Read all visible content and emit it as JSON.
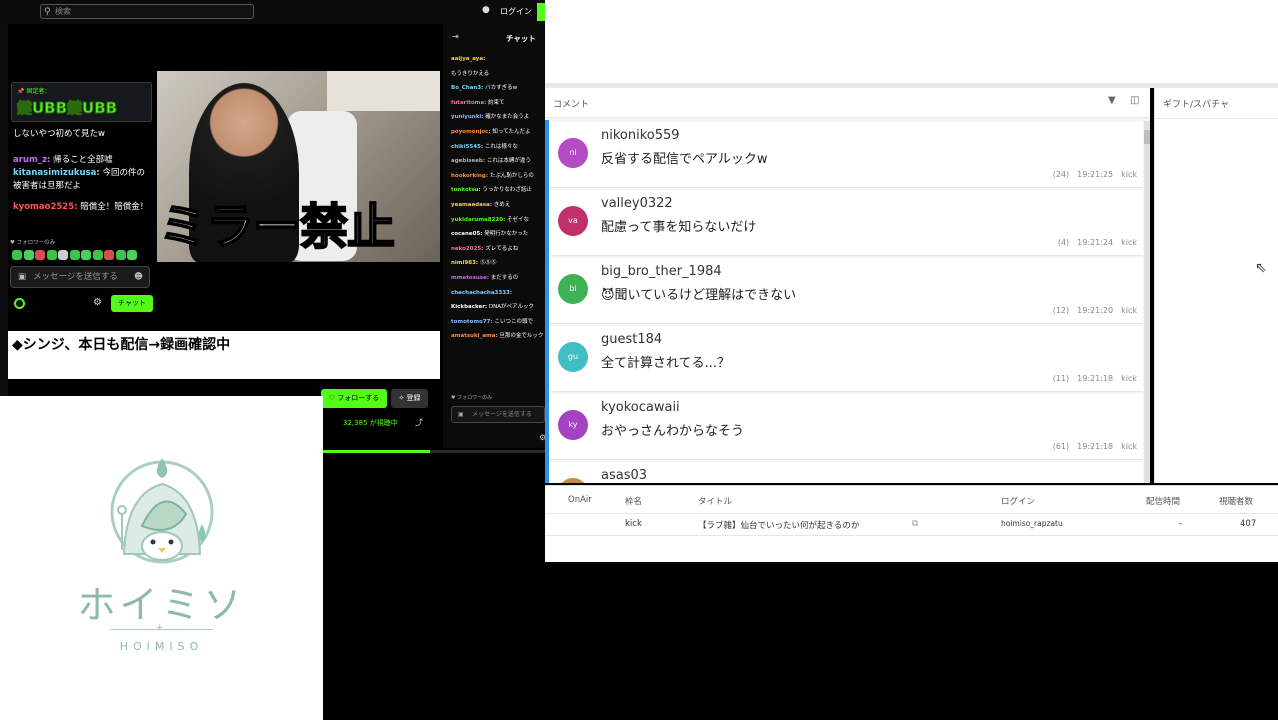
{
  "kick": {
    "search_placeholder": "検索",
    "login": "ログイン",
    "overlay_text": "ミラー禁止",
    "overlay_chat": {
      "pinned_label": "📌 固定者：",
      "big_emotes": "鍵UBB鍵UBB",
      "messages": [
        {
          "user": "",
          "text": "しないやつ初めて見たw",
          "color": "#ffffff"
        },
        {
          "user": "arum_z:",
          "text": " 帰ること全部嘘",
          "color": "#c96cf0"
        },
        {
          "user": "kitanasimizukusa:",
          "text": " 今回の件の被害者は旦那だよ",
          "color": "#7fd3ff"
        },
        {
          "user": "kyomao2525:",
          "text": " 賠償全！賠償金！",
          "color": "#ff5555"
        }
      ],
      "follow_only": "♥ フォロワーのみ",
      "input_placeholder": "メッセージを送信する",
      "chat_button": "チャット"
    },
    "subtitle": "◆シンジ、本日も配信→録画確認中",
    "follow_button": "♡ フォローする",
    "subscribe_button": "✧ 登録",
    "viewers": "32,385 が視聴中",
    "progress": 0.48,
    "chat_column": {
      "title": "チャット",
      "messages": [
        {
          "user": "aaijya_aya:",
          "text": "",
          "color": "#ffd24a"
        },
        {
          "user": "",
          "text": "もうきりかえる",
          "color": "#ffffff"
        },
        {
          "user": "Bo_Chan3:",
          "text": " バカすぎるw",
          "color": "#7fd3ff"
        },
        {
          "user": "futaritoma:",
          "text": " 約束て",
          "color": "#ff6fa8"
        },
        {
          "user": "yuniyunki:",
          "text": " 確かなまた会うよ",
          "color": "#8fbaff"
        },
        {
          "user": "poyomonjoc:",
          "text": " 知ってたんだよ",
          "color": "#ff8c42"
        },
        {
          "user": "chiki5545:",
          "text": " これは様々な",
          "color": "#7fd3ff"
        },
        {
          "user": "agebiseeb:",
          "text": " これは本縛が違う",
          "color": "#b5b5b5"
        },
        {
          "user": "hookorking:",
          "text": " たぶん恥かしらの",
          "color": "#ff8c42"
        },
        {
          "user": "tonkotsu:",
          "text": " うっかりなわざ話止",
          "color": "#53fc18"
        },
        {
          "user": "yeamaadasa:",
          "text": " きめえ",
          "color": "#ffd24a"
        },
        {
          "user": "yukidaruma8220:",
          "text": " そゼイな",
          "color": "#53fc18"
        },
        {
          "user": "cocane05:",
          "text": " 発明行かなかった",
          "color": "#ffffff"
        },
        {
          "user": "neko2025:",
          "text": " ズレてるよね",
          "color": "#ff6fa8"
        },
        {
          "user": "nimi983:",
          "text": " ⓈⓈⓈ",
          "color": "#ffd24a"
        },
        {
          "user": "mmetosuse:",
          "text": " まだするの",
          "color": "#c96cf0"
        },
        {
          "user": "chachachacha3333:",
          "text": " ",
          "color": "#7fd3ff"
        },
        {
          "user": "Kickbacker:",
          "text": " DNAがペアルック",
          "color": "#ffffff"
        },
        {
          "user": "tomotomo77:",
          "text": " こいつこの頭で",
          "color": "#8fbaff"
        },
        {
          "user": "amatsuki_ama:",
          "text": " 旦那の金でルック",
          "color": "#ff8c42"
        }
      ],
      "follow_only": "♥ フォロワーのみ",
      "input_placeholder": "メッセージを送信する"
    }
  },
  "comment_panel": {
    "title": "コメント",
    "comments": [
      {
        "avatar": "ni",
        "avatar_color": "#b44ac4",
        "name": "nikoniko559",
        "text": "反省する配信でペアルックw",
        "count": "(24)",
        "time": "19:21:25",
        "platform": "kick"
      },
      {
        "avatar": "va",
        "avatar_color": "#c0306b",
        "name": "valley0322",
        "text": "配慮って事を知らないだけ",
        "count": "(4)",
        "time": "19:21:24",
        "platform": "kick"
      },
      {
        "avatar": "bi",
        "avatar_color": "#3eb356",
        "name": "big_bro_ther_1984",
        "text": "😈聞いているけど理解はできない",
        "count": "(12)",
        "time": "19:21:20",
        "platform": "kick"
      },
      {
        "avatar": "gu",
        "avatar_color": "#3fbfc4",
        "name": "guest184",
        "text": "全て計算されてる...？",
        "count": "(11)",
        "time": "19:21:18",
        "platform": "kick"
      },
      {
        "avatar": "ky",
        "avatar_color": "#a342c2",
        "name": "kyokocawaii",
        "text": "おやっさんわからなそう",
        "count": "(61)",
        "time": "19:21:18",
        "platform": "kick"
      },
      {
        "avatar": "as",
        "avatar_color": "#c48c3e",
        "name": "asas03",
        "text": "",
        "count": "",
        "time": "",
        "platform": ""
      }
    ]
  },
  "gift_panel": {
    "title": "ギフト/スパチャ"
  },
  "table": {
    "headers": [
      "OnAir",
      "枠名",
      "タイトル",
      "ログイン",
      "配信時間",
      "視聴者数"
    ],
    "rows": [
      {
        "onair": "",
        "frame": "kick",
        "title": "【ラブ雑】仙台でいったい何が起きるのか",
        "login": "hoimiso_rapzatu",
        "duration": "-",
        "viewers": "407"
      }
    ]
  },
  "logo": {
    "name": "ホイミソ",
    "sub": "HOIMISO"
  },
  "colors": {
    "kick_green": "#53fc18",
    "accent_blue": "#2d8ff0",
    "logo_teal": "#8fb9ad"
  }
}
